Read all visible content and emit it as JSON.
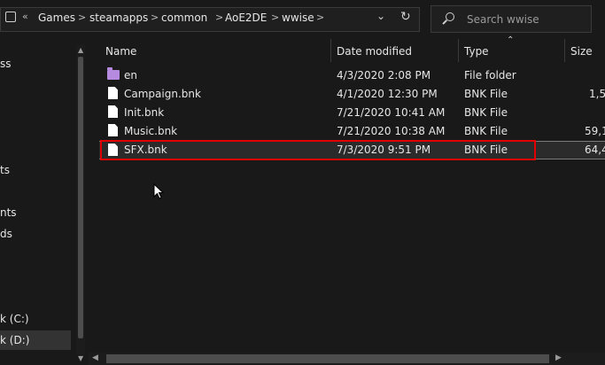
{
  "address": {
    "overflow": "«",
    "crumbs": [
      "Games",
      "steamapps",
      "common",
      "AoE2DE",
      "wwise"
    ],
    "separator": ">",
    "dropdown_icon": "chevron-down-icon",
    "refresh_icon": "refresh-icon"
  },
  "search": {
    "placeholder": "Search wwise"
  },
  "columns": {
    "name": "Name",
    "date": "Date modified",
    "type": "Type",
    "size": "Size"
  },
  "files": [
    {
      "name": "en",
      "date": "4/3/2020 2:08 PM",
      "type": "File folder",
      "size": "",
      "icon": "folder-icon"
    },
    {
      "name": "Campaign.bnk",
      "date": "4/1/2020 12:30 PM",
      "type": "BNK File",
      "size": "1,5",
      "icon": "file-icon"
    },
    {
      "name": "Init.bnk",
      "date": "7/21/2020 10:41 AM",
      "type": "BNK File",
      "size": "",
      "icon": "file-icon"
    },
    {
      "name": "Music.bnk",
      "date": "7/21/2020 10:38 AM",
      "type": "BNK File",
      "size": "59,1",
      "icon": "file-icon"
    },
    {
      "name": "SFX.bnk",
      "date": "7/3/2020 9:51 PM",
      "type": "BNK File",
      "size": "64,4",
      "icon": "file-icon"
    }
  ],
  "nav": {
    "items": [
      "ss",
      "ts",
      "nts",
      "ds",
      "k (C:)",
      "k (D:)"
    ]
  },
  "colors": {
    "background": "#191919",
    "highlight": "#e00000",
    "folder": "#b58ae0"
  }
}
